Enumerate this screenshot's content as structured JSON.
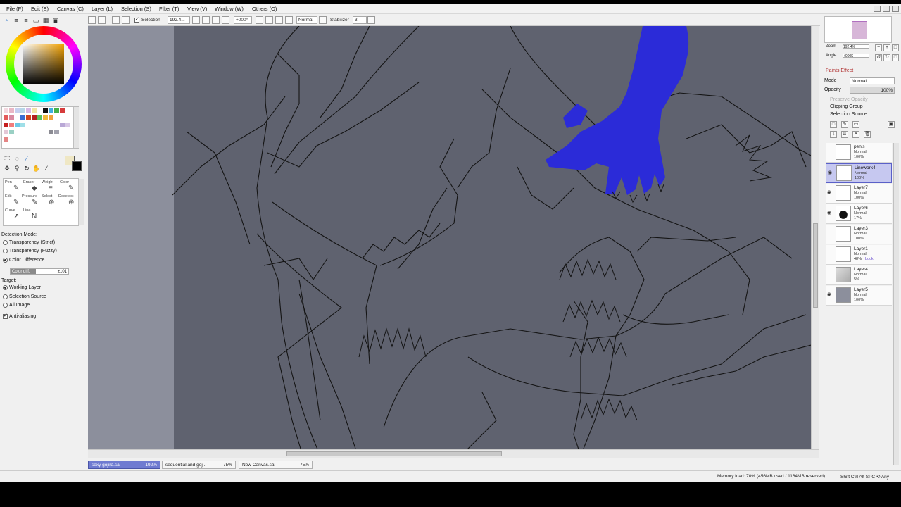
{
  "menu": [
    "File (F)",
    "Edit (E)",
    "Canvas (C)",
    "Layer (L)",
    "Selection (S)",
    "Filter (T)",
    "View (V)",
    "Window (W)",
    "Others (O)"
  ],
  "toolbar": {
    "selection_label": "Selection",
    "zoom_value": "192.4...",
    "angle_value": "+000°",
    "blend_mode": "Normal",
    "stabilizer_label": "Stabilizer",
    "stabilizer_value": "3"
  },
  "brush_tools": [
    "Pen",
    "Eraser",
    "Weight",
    "Color",
    "Edit",
    "Pressure",
    "Select",
    "Deselect",
    "Curve",
    "Line"
  ],
  "detection": {
    "title": "Detection Mode:",
    "options": [
      "Transparency (Strict)",
      "Transparency (Fuzzy)",
      "Color Difference"
    ],
    "selected": "Color Difference",
    "slider_label": "Color diff.",
    "slider_value": "±101",
    "slider_level": 0.44
  },
  "target": {
    "title": "Target:",
    "options": [
      "Working Layer",
      "Selection Source",
      "All Image"
    ],
    "selected": "Working Layer",
    "antialias_label": "Anti-aliasing",
    "antialias_checked": true
  },
  "navigator": {
    "zoom_label": "Zoom",
    "zoom_value": "192.4%",
    "angle_label": "Angle",
    "angle_value": "+000$"
  },
  "layer_props": {
    "paint_effect": "Paints Effect",
    "mode_label": "Mode",
    "mode_value": "Normal",
    "opacity_label": "Opacity",
    "opacity_value": "100%",
    "preserve_opacity": "Preserve Opacity",
    "clipping_group": "Clipping Group",
    "selection_source": "Selection Source"
  },
  "layers": [
    {
      "name": "penis",
      "mode": "Normal",
      "opacity": "100%",
      "extra": "",
      "selected": false,
      "visible": false
    },
    {
      "name": "Linework4",
      "mode": "Normal",
      "opacity": "100%",
      "extra": "",
      "selected": true,
      "visible": true
    },
    {
      "name": "Layer7",
      "mode": "Normal",
      "opacity": "100%",
      "extra": "",
      "selected": false,
      "visible": true
    },
    {
      "name": "Layer6",
      "mode": "Normal",
      "opacity": "17%",
      "extra": "",
      "selected": false,
      "visible": true
    },
    {
      "name": "Layer3",
      "mode": "Normal",
      "opacity": "100%",
      "extra": "",
      "selected": false,
      "visible": false
    },
    {
      "name": "Layer1",
      "mode": "Normal",
      "opacity": "48%",
      "extra": "Lock",
      "selected": false,
      "visible": false
    },
    {
      "name": "Layer4",
      "mode": "Normal",
      "opacity": "5%",
      "extra": "",
      "selected": false,
      "visible": false
    },
    {
      "name": "Layer5",
      "mode": "Normal",
      "opacity": "100%",
      "extra": "",
      "selected": false,
      "visible": true
    }
  ],
  "documents": [
    {
      "name": "sexy gojira.sai",
      "zoom": "192%",
      "active": true
    },
    {
      "name": "sequential and goj...",
      "zoom": "75%",
      "active": false
    },
    {
      "name": "New Canvas.sai",
      "zoom": "75%",
      "active": false
    }
  ],
  "status": {
    "memory": "Memory load: 70% (456MB used / 1164MB reserved)",
    "keys": "Shift Ctrl Alt SPC ⟲ Any"
  },
  "colors": {
    "canvas_bg": "#5f626f",
    "highlight_blue": "#2b2bd8",
    "accent": "#6f7bd1"
  }
}
